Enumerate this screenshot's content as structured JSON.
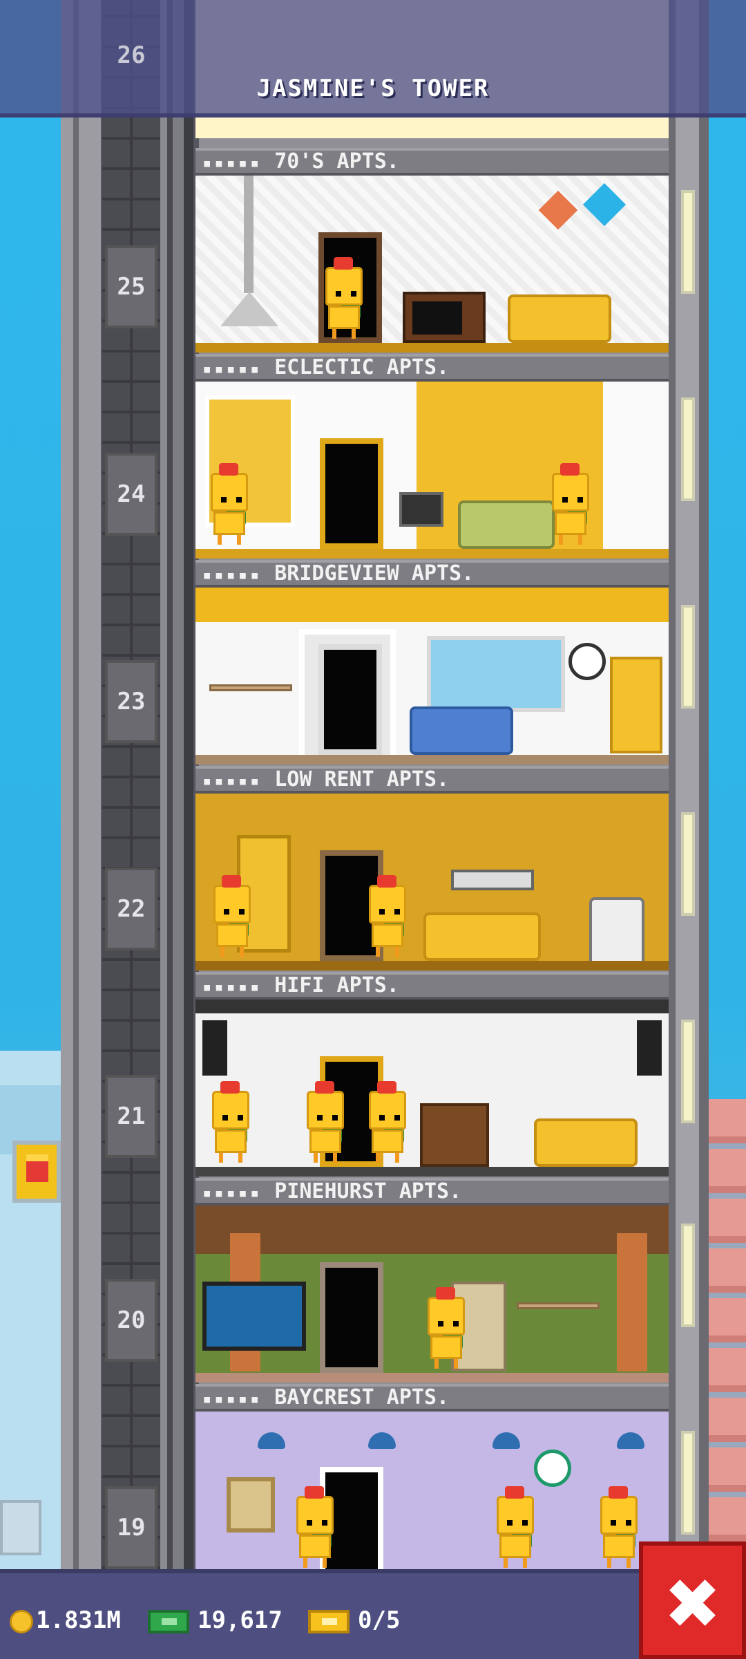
{
  "header": {
    "tower_name": "JASMINE'S TOWER",
    "top_floor_number": "26"
  },
  "floors": [
    {
      "number": "25",
      "name": "70'S APTS.",
      "stars": "▪▪▪▪▪"
    },
    {
      "number": "24",
      "name": "ECLECTIC APTS.",
      "stars": "▪▪▪▪▪"
    },
    {
      "number": "23",
      "name": "BRIDGEVIEW APTS.",
      "stars": "▪▪▪▪▪"
    },
    {
      "number": "22",
      "name": "LOW RENT APTS.",
      "stars": "▪▪▪▪▪"
    },
    {
      "number": "21",
      "name": "HIFI APTS.",
      "stars": "▪▪▪▪▪"
    },
    {
      "number": "20",
      "name": "PINEHURST APTS.",
      "stars": "▪▪▪▪▪"
    },
    {
      "number": "19",
      "name": "BAYCREST APTS.",
      "stars": "▪▪▪▪▪"
    }
  ],
  "footer": {
    "coins": "1.831M",
    "bux": "19,617",
    "tickets": "0/5",
    "close_label": "✖"
  },
  "colors": {
    "sky": "#2fb7ec",
    "header_bg": "#4e528c",
    "close_button": "#e02a2a",
    "coin": "#f6c22c",
    "bux": "#2ea84a"
  }
}
